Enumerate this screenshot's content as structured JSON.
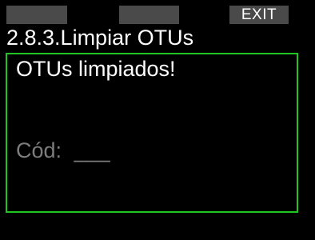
{
  "softkeys": {
    "left_label": "",
    "middle_label": "",
    "right_label": "EXIT"
  },
  "header": {
    "title": "2.8.3.Limpiar OTUs"
  },
  "panel": {
    "message": "OTUs limpiados!",
    "code_label": "Cód:",
    "code_value": "___",
    "border_color": "#21c521"
  },
  "colors": {
    "background": "#000000",
    "text": "#ffffff",
    "softkey": "#4a4a4a",
    "dim_text": "#7d7d7d"
  }
}
